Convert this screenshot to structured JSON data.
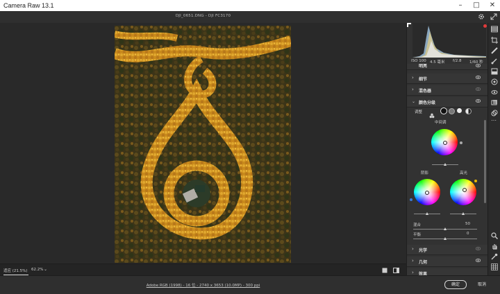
{
  "window": {
    "title": "Camera Raw 13.1",
    "controls": [
      "minimize-icon",
      "maximize-icon",
      "close-icon"
    ]
  },
  "filebar": {
    "filename": "DJI_0651.DNG - DJI FC3170"
  },
  "histogram": {
    "info": [
      "ISO 100",
      "4.5 毫米",
      "f/2.8",
      "1/60 秒"
    ]
  },
  "panel": {
    "sections": [
      {
        "label": "细节"
      },
      {
        "label": "混色器"
      },
      {
        "label": "颜色分级"
      },
      {
        "label": "光学"
      },
      {
        "label": "几何"
      },
      {
        "label": "效果"
      }
    ],
    "top_partial": "明亮",
    "grading": {
      "adjust_label": "调整",
      "midtones": "中间调",
      "shadows": "阴影",
      "highlights": "高光",
      "blend_label": "混合",
      "blend_value": "50",
      "balance_label": "平衡",
      "balance_value": "0"
    }
  },
  "zoombar": {
    "fit": "适应 (21.5%)",
    "zoom": "62.2%"
  },
  "footer": {
    "workflow": "Adobe RGB (1998) - 16 位 - 2740 x 3653 (10.0MP) - 300 ppi",
    "done": "确定",
    "cancel": "取消"
  },
  "colors": {
    "accent": "#3a7bd5",
    "panel_bg": "#323232",
    "foliage": "#d9a227"
  }
}
